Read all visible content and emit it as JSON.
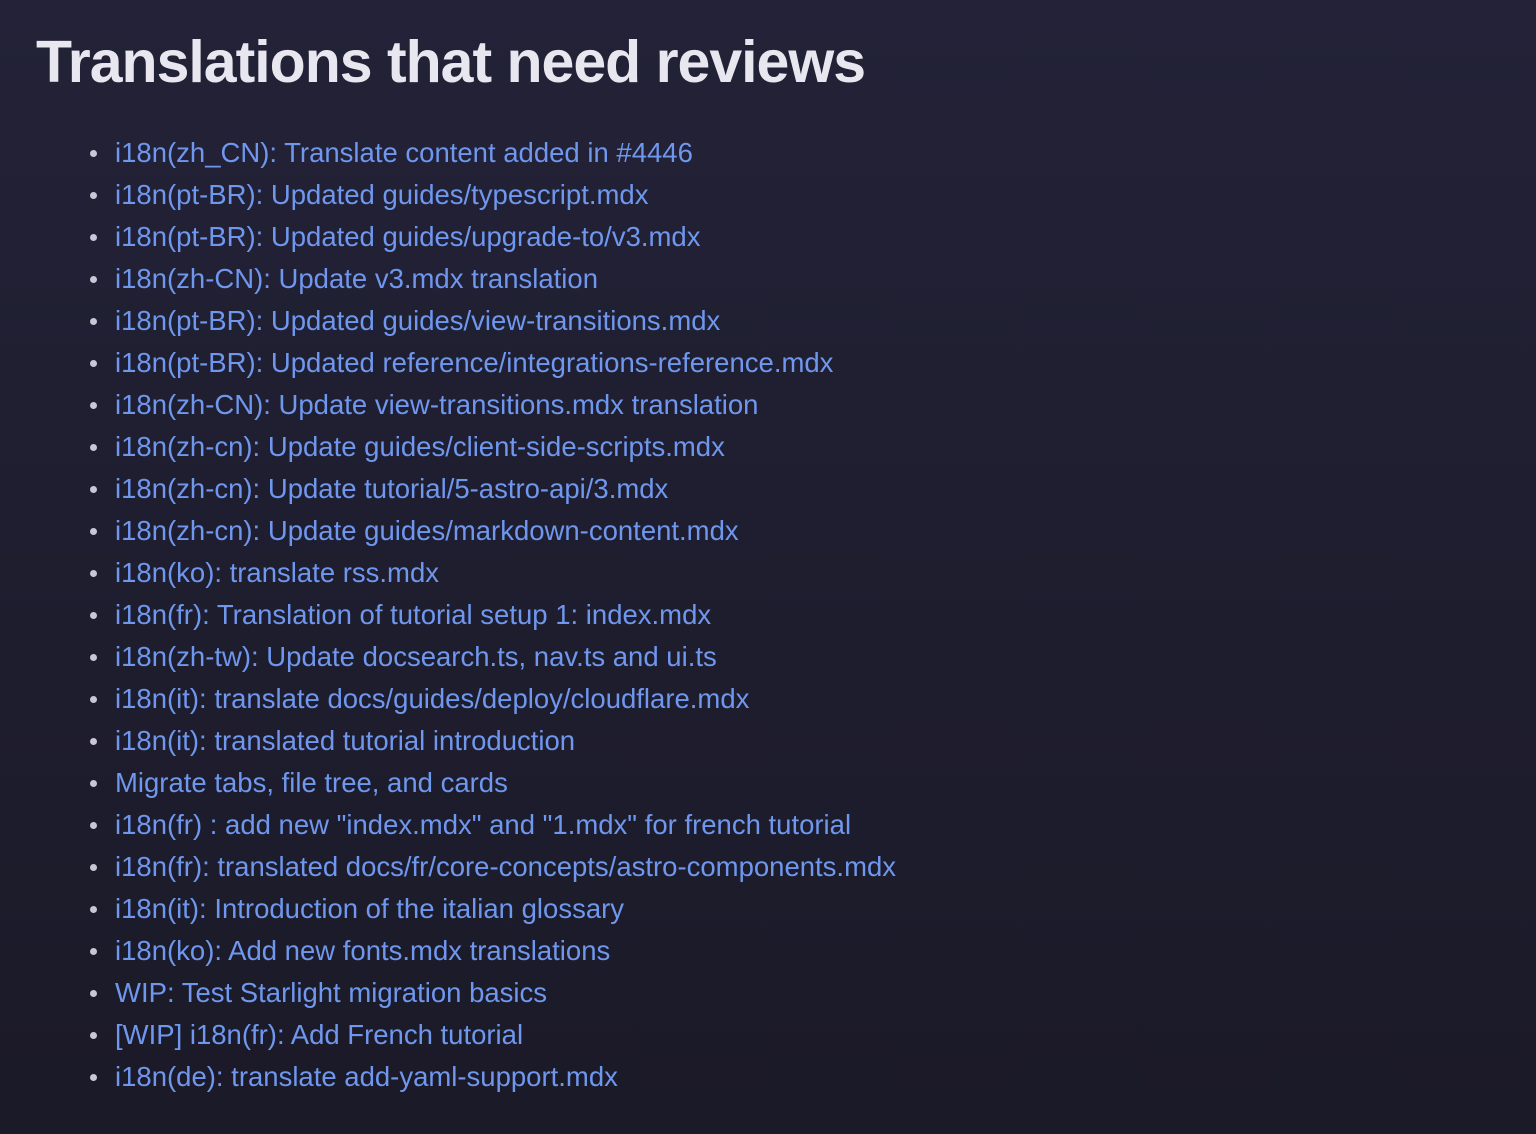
{
  "page": {
    "title": "Translations that need reviews"
  },
  "colors": {
    "background": "#201f30",
    "title": "#e8e6ef",
    "link": "#6f97ee",
    "bullet": "#c9c7d6"
  },
  "pull_requests": [
    {
      "label": "i18n(zh_CN): Translate content added in #4446"
    },
    {
      "label": "i18n(pt-BR): Updated guides/typescript.mdx"
    },
    {
      "label": "i18n(pt-BR): Updated guides/upgrade-to/v3.mdx"
    },
    {
      "label": "i18n(zh-CN): Update v3.mdx translation"
    },
    {
      "label": "i18n(pt-BR): Updated guides/view-transitions.mdx"
    },
    {
      "label": "i18n(pt-BR): Updated reference/integrations-reference.mdx"
    },
    {
      "label": "i18n(zh-CN): Update view-transitions.mdx translation"
    },
    {
      "label": "i18n(zh-cn): Update guides/client-side-scripts.mdx"
    },
    {
      "label": "i18n(zh-cn): Update tutorial/5-astro-api/3.mdx"
    },
    {
      "label": "i18n(zh-cn): Update guides/markdown-content.mdx"
    },
    {
      "label": "i18n(ko): translate rss.mdx"
    },
    {
      "label": "i18n(fr): Translation of tutorial setup 1: index.mdx"
    },
    {
      "label": "i18n(zh-tw): Update docsearch.ts, nav.ts and ui.ts"
    },
    {
      "label": "i18n(it): translate docs/guides/deploy/cloudflare.mdx"
    },
    {
      "label": "i18n(it): translated tutorial introduction"
    },
    {
      "label": "Migrate tabs, file tree, and cards"
    },
    {
      "label": "i18n(fr) : add new \"index.mdx\" and \"1.mdx\" for french tutorial"
    },
    {
      "label": "i18n(fr): translated docs/fr/core-concepts/astro-components.mdx"
    },
    {
      "label": "i18n(it): Introduction of the italian glossary"
    },
    {
      "label": "i18n(ko): Add new fonts.mdx translations"
    },
    {
      "label": "WIP: Test Starlight migration basics"
    },
    {
      "label": "[WIP] i18n(fr): Add French tutorial"
    },
    {
      "label": "i18n(de): translate add-yaml-support.mdx"
    }
  ]
}
